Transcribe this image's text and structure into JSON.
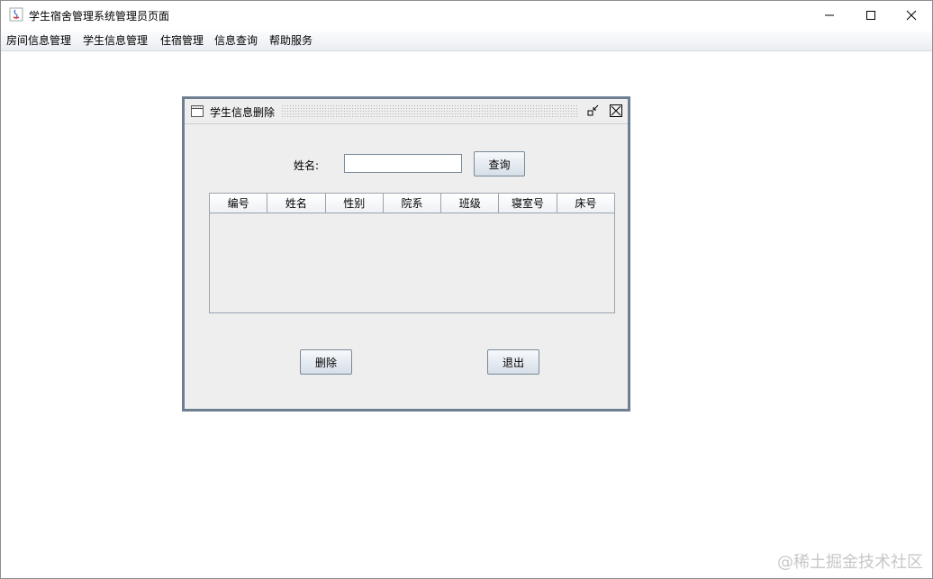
{
  "window": {
    "title": "学生宿舍管理系统管理员页面"
  },
  "menubar": {
    "items": [
      "房间信息管理",
      "学生信息管理",
      "住宿管理",
      "信息查询",
      "帮助服务"
    ]
  },
  "dialog": {
    "title": "学生信息删除",
    "name_label": "姓名:",
    "name_value": "",
    "query_button": "查询",
    "table_columns": [
      "编号",
      "姓名",
      "性别",
      "院系",
      "班级",
      "寝室号",
      "床号"
    ],
    "table_rows": [],
    "delete_button": "删除",
    "exit_button": "退出"
  },
  "watermark": "@稀土掘金技术社区"
}
